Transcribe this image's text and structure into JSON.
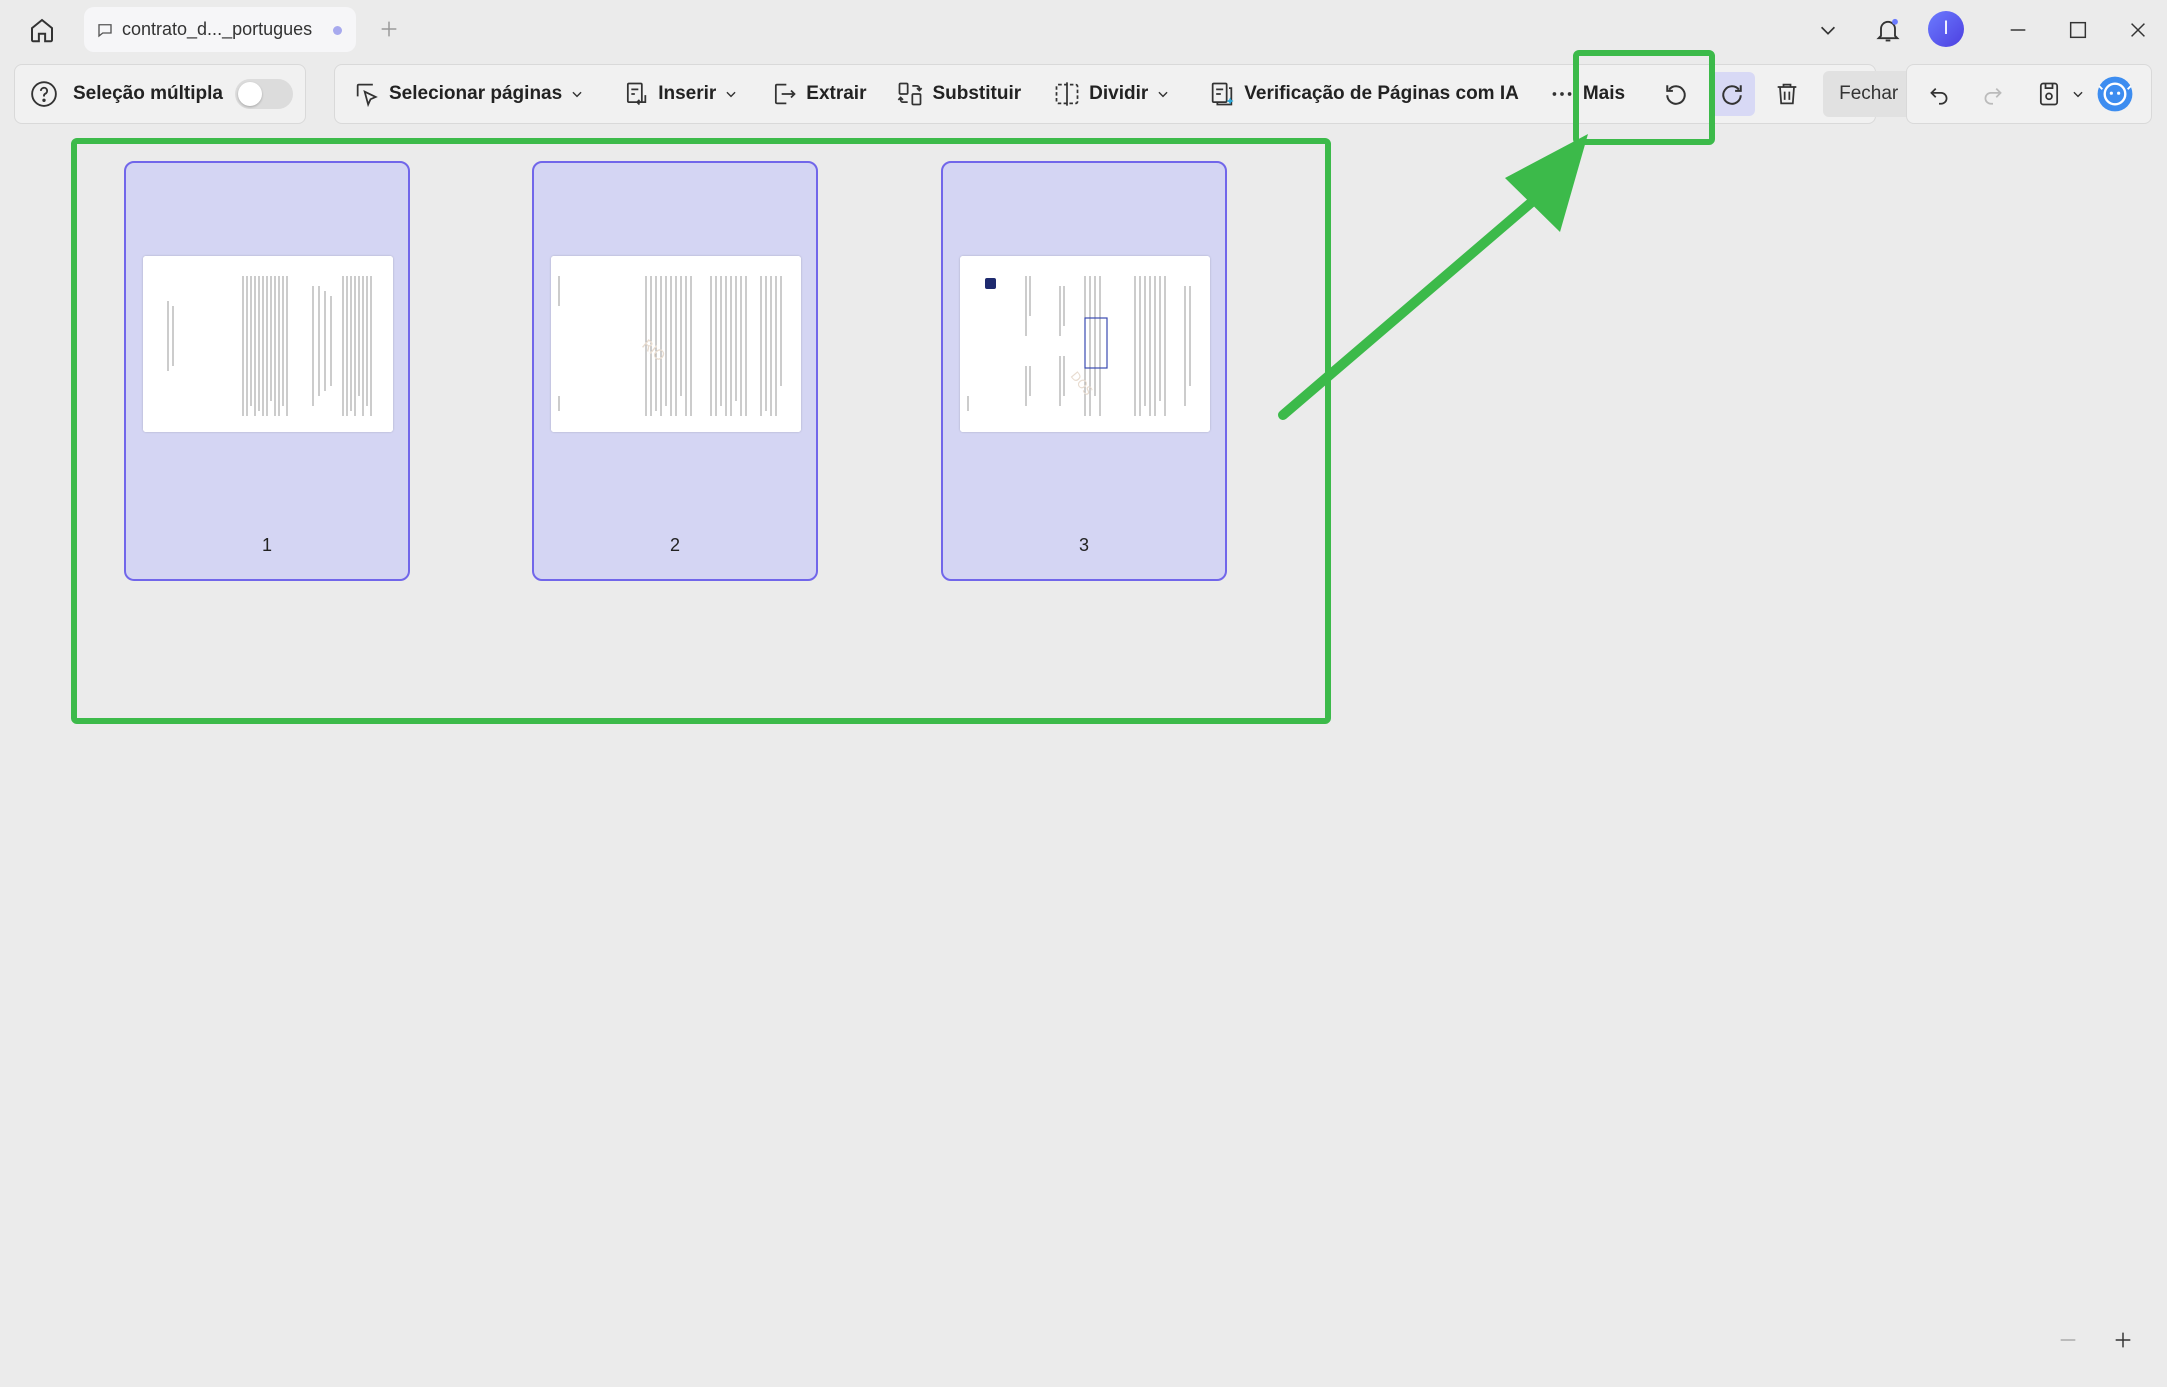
{
  "window": {
    "tab_title": "contrato_d..._portugues",
    "avatar_initial": "I"
  },
  "toolbar": {
    "multi_select_label": "Seleção múltipla",
    "select_pages_label": "Selecionar páginas",
    "insert_label": "Inserir",
    "extract_label": "Extrair",
    "replace_label": "Substituir",
    "split_label": "Dividir",
    "ai_check_label": "Verificação de Páginas com IA",
    "more_label": "Mais",
    "close_label": "Fechar"
  },
  "pages": [
    {
      "number": "1"
    },
    {
      "number": "2"
    },
    {
      "number": "3"
    }
  ],
  "colors": {
    "accent": "#7166ea",
    "page_selected_bg": "#d4d5f3",
    "annotation": "#3cba4a"
  }
}
